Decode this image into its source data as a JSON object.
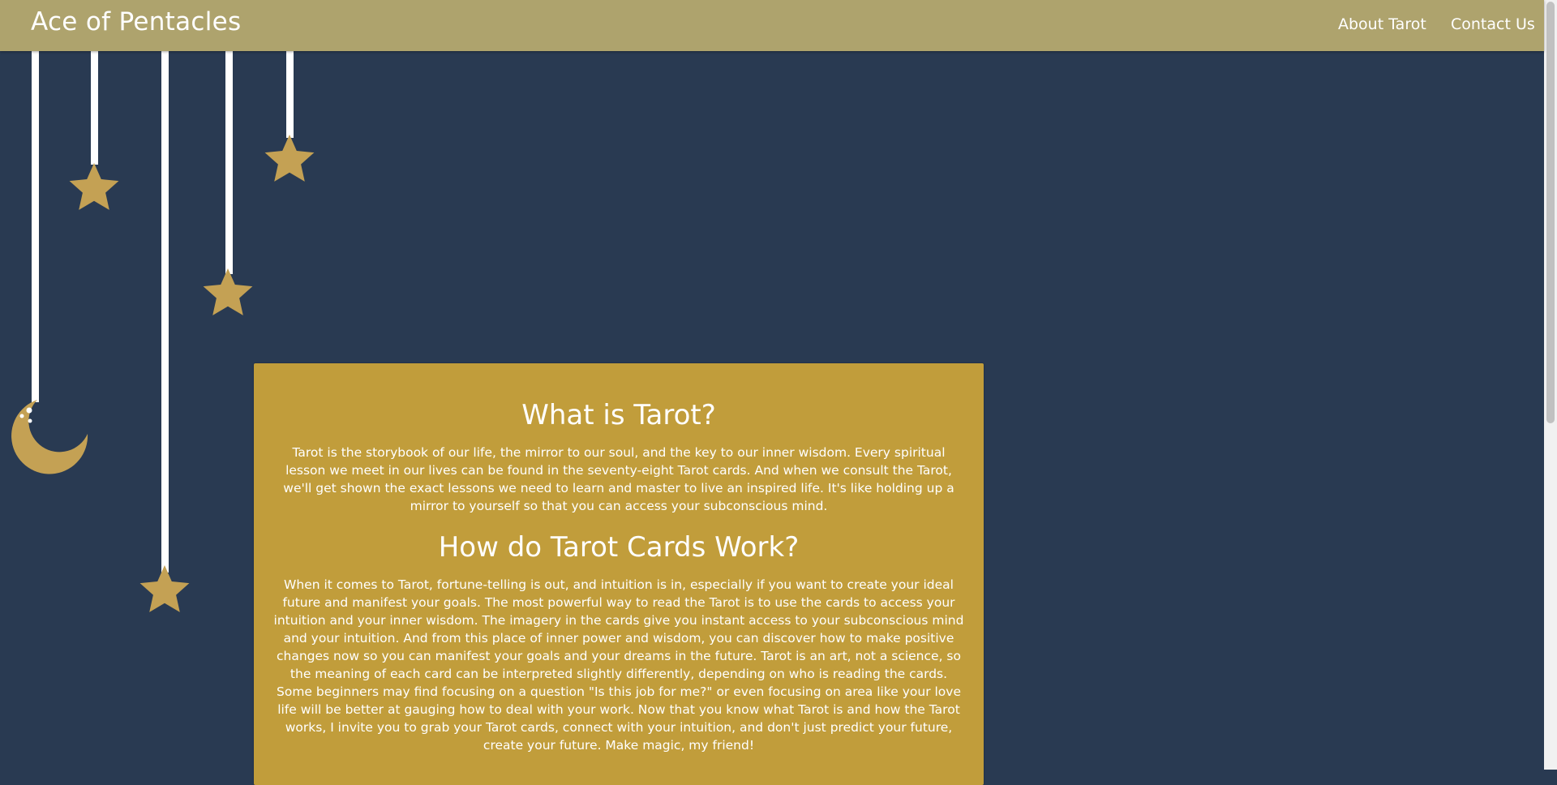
{
  "header": {
    "brand": "Ace of Pentacles",
    "nav": [
      {
        "label": "About Tarot"
      },
      {
        "label": "Contact Us"
      }
    ]
  },
  "colors": {
    "page_background": "#293a52",
    "navbar": "#aea36d",
    "card": "#c19d3b",
    "star": "#c4a154",
    "string": "#ffffff"
  },
  "decorations": {
    "icons": [
      "star-icon",
      "star-icon",
      "star-icon",
      "star-icon",
      "star-icon",
      "crescent-moon-icon"
    ]
  },
  "main": {
    "sections": [
      {
        "heading": "What is Tarot?",
        "body": "Tarot is the storybook of our life, the mirror to our soul, and the key to our inner wisdom.  Every spiritual lesson we meet in our lives can be found in the seventy-eight Tarot cards. And when we consult the Tarot, we'll get shown the exact lessons we need to learn and master to live an inspired life. It's like holding up a mirror to yourself so that you can access your subconscious mind."
      },
      {
        "heading": "How do Tarot Cards Work?",
        "body": "When it comes to Tarot, fortune-telling is out, and intuition is in, especially if you want to create your ideal future and manifest your goals.  The most powerful way to read the Tarot is to use the cards to access your intuition and your inner wisdom. The imagery in the cards give you instant access to your subconscious mind and your intuition. And from this place of inner power and wisdom, you can discover how to make positive changes now so you can manifest your goals and your dreams in the future.  Tarot is an art, not a science, so the meaning of each card can be interpreted slightly differently, depending on who is reading the cards. Some beginners may find focusing on a question \"Is this job for me?\" or even focusing on area like your love life will be better at gauging how to deal with your work. Now that you know what Tarot is and how the Tarot works, I invite you to grab your Tarot cards, connect with your intuition, and don't just predict your future, create your future. Make magic, my friend!"
      }
    ]
  }
}
